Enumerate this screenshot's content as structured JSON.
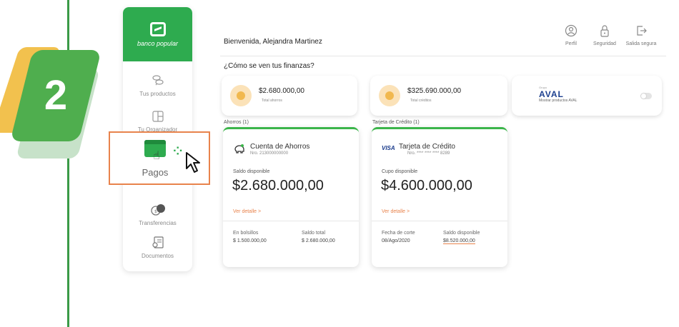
{
  "step": {
    "number": "2"
  },
  "brand": {
    "name": "banco popular"
  },
  "sidebar": {
    "items": [
      {
        "label": "Tus productos",
        "icon": "coins-icon"
      },
      {
        "label": "Tu Organizador",
        "icon": "organizer-icon"
      },
      {
        "label": "Pagos",
        "icon": "payment-icon"
      },
      {
        "label": "Transferencias",
        "icon": "transfer-icon"
      },
      {
        "label": "Documentos",
        "icon": "document-icon"
      }
    ]
  },
  "header": {
    "welcome": "Bienvenida, Alejandra Martinez",
    "actions": [
      {
        "label": "Perfil",
        "icon": "user-icon"
      },
      {
        "label": "Seguridad",
        "icon": "lock-icon"
      },
      {
        "label": "Salida segura",
        "icon": "logout-icon"
      }
    ]
  },
  "finances": {
    "title": "¿Cómo se ven tus finanzas?",
    "savings_total": {
      "amount": "$2.680.000,00",
      "label": "Total ahorros"
    },
    "credit_total": {
      "amount": "$325.690.000,00",
      "label": "Total créditos"
    },
    "aval": {
      "logo": "AVAL",
      "logo_small": "Grupo",
      "label": "Mostrar productos AVAL"
    }
  },
  "sections": {
    "savings": "Ahorros (1)",
    "credit": "Tarjeta de Crédito (1)"
  },
  "savings_card": {
    "name": "Cuenta de Ahorros",
    "number": "Nro. 213000000000",
    "available_label": "Saldo disponible",
    "balance": "$2.680.000,00",
    "link": "Ver detalle >",
    "foot_left_label": "En bolsillos",
    "foot_left_value": "$ 1.500.000,00",
    "foot_right_label": "Saldo total",
    "foot_right_value": "$ 2.680.000,00"
  },
  "credit_card": {
    "brand": "VISA",
    "name": "Tarjeta de Crédito",
    "number": "Nro. **** **** **** 8289",
    "available_label": "Cupo disponible",
    "balance": "$4.600.000,00",
    "link": "Ver detalle >",
    "foot_left_label": "Fecha de corte",
    "foot_left_value": "08/Ago/2020",
    "foot_right_label": "Saldo disponible",
    "foot_right_value": "$8.520.000,00"
  },
  "colors": {
    "brand_green": "#2eab4f",
    "accent_orange": "#e8834c",
    "highlight_yellow": "#f2c14e"
  }
}
